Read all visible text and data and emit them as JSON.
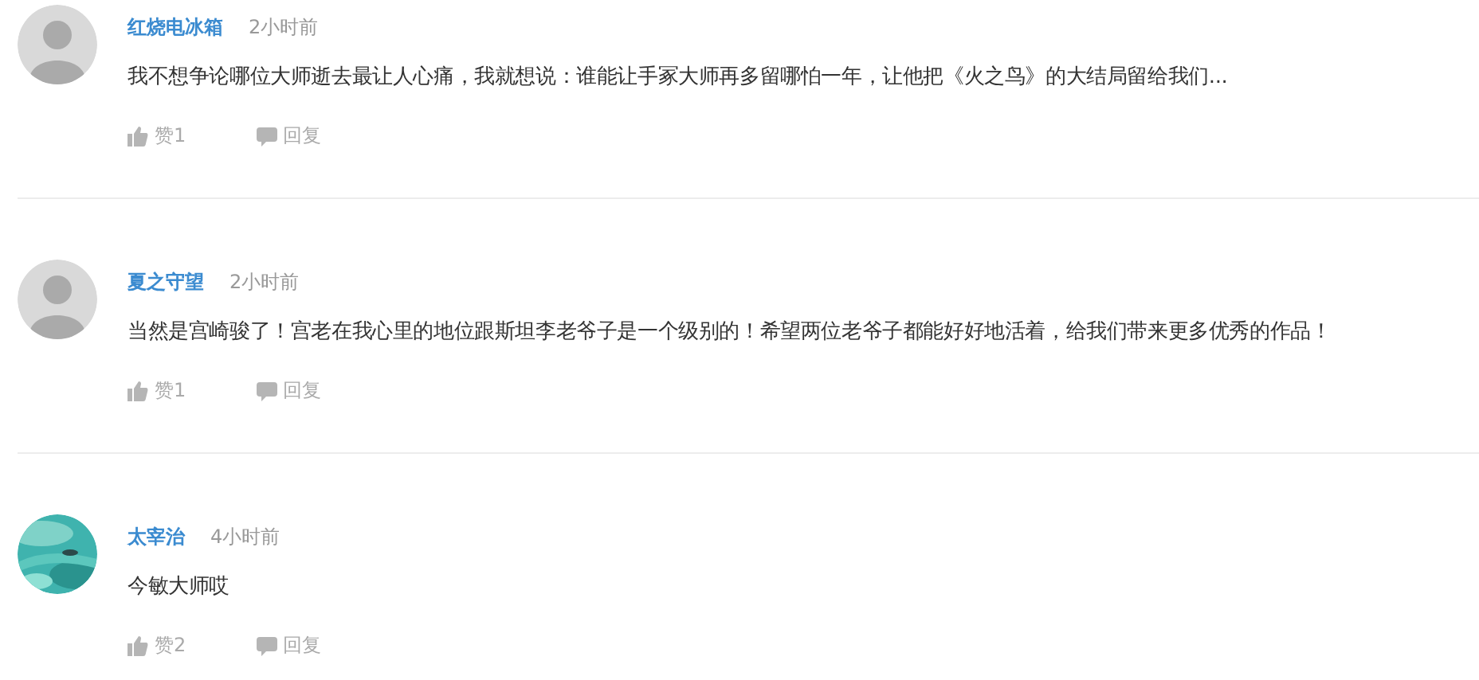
{
  "comments": [
    {
      "avatar": {
        "kind": "silhouette"
      },
      "user": "红烧电冰箱",
      "time": "2小时前",
      "text": "我不想争论哪位大师逝去最让人心痛，我就想说：谁能让手冢大师再多留哪怕一年，让他把《火之鸟》的大结局留给我们...",
      "like": "赞1",
      "reply": "回复"
    },
    {
      "avatar": {
        "kind": "silhouette"
      },
      "user": "夏之守望",
      "time": "2小时前",
      "text": "当然是宫崎骏了！宫老在我心里的地位跟斯坦李老爷子是一个级别的！希望两位老爷子都能好好地活着，给我们带来更多优秀的作品！",
      "like": "赞1",
      "reply": "回复"
    },
    {
      "user": "太宰治",
      "time": "4小时前",
      "text": "今敏大师哎",
      "like": "赞2",
      "reply": "回复"
    }
  ]
}
